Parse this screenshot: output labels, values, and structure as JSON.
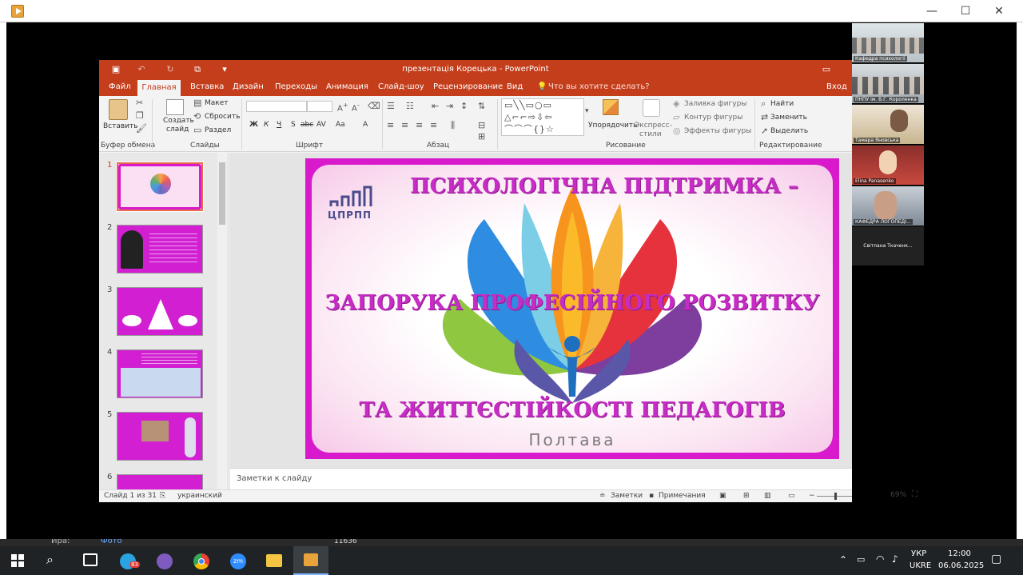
{
  "ppt": {
    "window_title": "презентація Корецька - PowerPoint",
    "tabs": [
      "Файл",
      "Главная",
      "Вставка",
      "Дизайн",
      "Переходы",
      "Анимация",
      "Слайд-шоу",
      "Рецензирование",
      "Вид"
    ],
    "active_tab": "Главная",
    "tell_me": "Что вы хотите сделать?",
    "signin": "Вход",
    "ribbon": {
      "paste": "Вставить",
      "new_slide_1": "Создать",
      "new_slide_2": "слайд",
      "layout": "Макет",
      "reset": "Сбросить",
      "section": "Раздел",
      "arrange": "Упорядочить",
      "quick_styles_1": "Экспресс-",
      "quick_styles_2": "стили",
      "shape_fill": "Заливка фигуры",
      "shape_outline": "Контур фигуры",
      "shape_effects": "Эффекты фигуры",
      "find": "Найти",
      "replace": "Заменить",
      "select": "Выделить",
      "font_buttons": [
        "Ж",
        "К",
        "Ч",
        "S",
        "abc",
        "AV",
        "Aa",
        "A"
      ],
      "groups": {
        "clipboard": "Буфер обмена",
        "slides": "Слайды",
        "font": "Шрифт",
        "paragraph": "Абзац",
        "drawing": "Рисование",
        "editing": "Редактирование"
      }
    },
    "thumb_numbers": [
      "1",
      "2",
      "3",
      "4",
      "5",
      "6"
    ],
    "slide": {
      "line1": "ПСИХОЛОГІЧНА ПІДТРИМКА –",
      "line2": "ЗАПОРУКА ПРОФЕСІЙНОГО РОЗВИТКУ",
      "line3": "ТА ЖИТТЄСТІЙКОСТІ ПЕДАГОГІВ",
      "city": "Полтава",
      "logo_text": "ЦПРПП"
    },
    "notes_placeholder": "Заметки к слайду",
    "status": {
      "slide_info": "Слайд 1 из 31",
      "language": "украинский",
      "notes": "Заметки",
      "comments": "Примечания",
      "zoom": "69%"
    }
  },
  "zoom_participants": [
    "Кафедра психології",
    "ПНПУ ім. В.Г. Короленка",
    "Тамара Яновська",
    "Elina Panasenko",
    "КАФЕДРА ЛОГОПЕДІ...",
    "Світлана Ткаченк..."
  ],
  "taskbar": {
    "notif_text_1": "Ира:",
    "notif_text_2": "Фото",
    "notif_count": "11636",
    "telegram_badge": "83",
    "zoom_label": "zm",
    "lang_1": "УКР",
    "lang_2": "UKRE",
    "time": "12:00",
    "date": "06.06.2025"
  },
  "colors": {
    "ppt_accent": "#c43e1c",
    "slide_border": "#d819cc",
    "slide_text": "#c72cc6"
  }
}
